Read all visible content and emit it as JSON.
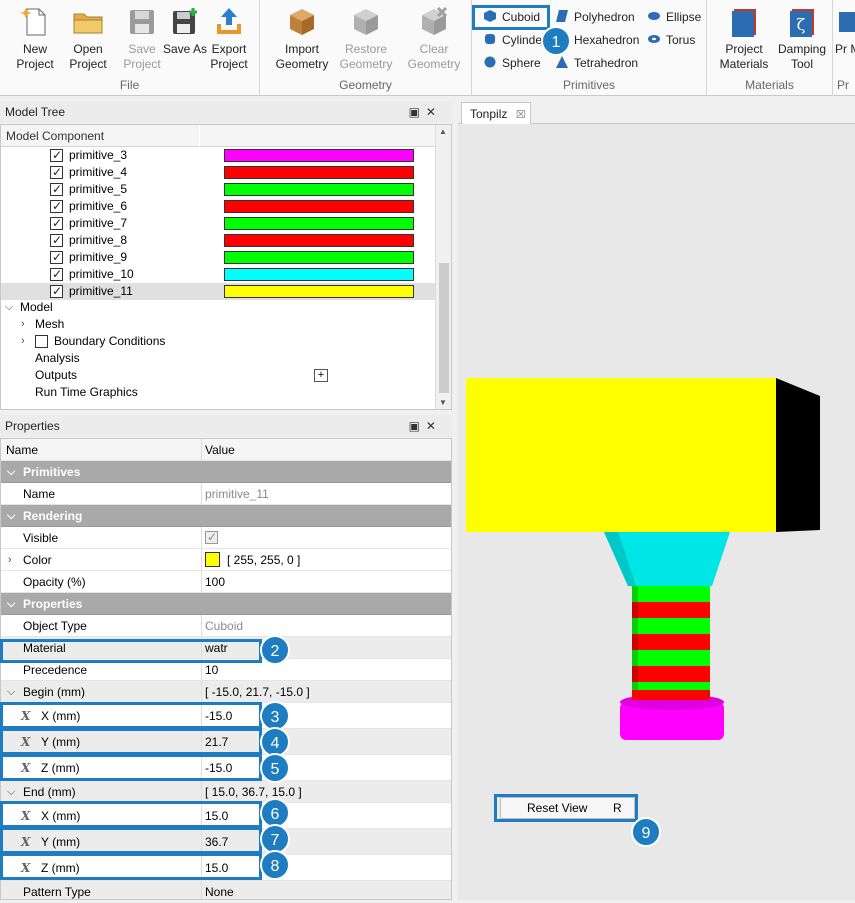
{
  "ribbon": {
    "groups": {
      "file": "File",
      "geometry": "Geometry",
      "primitives": "Primitives",
      "materials": "Materials",
      "last": "Pr"
    },
    "buttons": {
      "new_project": "New Project",
      "open_project": "Open Project",
      "save_project": "Save Project",
      "save_as": "Save As",
      "export_project": "Export Project",
      "import_geometry": "Import Geometry",
      "restore_geometry": "Restore Geometry",
      "clear_geometry": "Clear Geometry",
      "project_materials": "Project Materials",
      "damping_tool": "Damping Tool",
      "partial": "Pr M"
    },
    "primitives": {
      "cuboid": "Cuboid",
      "cylinder": "Cylinder",
      "sphere": "Sphere",
      "polyhedron": "Polyhedron",
      "hexahedron": "Hexahedron",
      "tetrahedron": "Tetrahedron",
      "ellipse": "Ellipse",
      "torus": "Torus"
    }
  },
  "model_tree": {
    "title": "Model Tree",
    "column": "Model Component",
    "primitives": [
      {
        "label": "primitive_3",
        "color": "#ff00ff"
      },
      {
        "label": "primitive_4",
        "color": "#ff0000"
      },
      {
        "label": "primitive_5",
        "color": "#00ff00"
      },
      {
        "label": "primitive_6",
        "color": "#ff0000"
      },
      {
        "label": "primitive_7",
        "color": "#00ff00"
      },
      {
        "label": "primitive_8",
        "color": "#ff0000"
      },
      {
        "label": "primitive_9",
        "color": "#00ff00"
      },
      {
        "label": "primitive_10",
        "color": "#00ffff"
      },
      {
        "label": "primitive_11",
        "color": "#ffff00"
      }
    ],
    "model": "Model",
    "mesh": "Mesh",
    "boundary_conditions": "Boundary Conditions",
    "analysis": "Analysis",
    "outputs": "Outputs",
    "outputs_add": "+",
    "run_time_graphics": "Run Time Graphics"
  },
  "properties": {
    "title": "Properties",
    "col_name": "Name",
    "col_value": "Value",
    "sec_primitives": "Primitives",
    "name_label": "Name",
    "name_value": "primitive_11",
    "sec_rendering": "Rendering",
    "visible_label": "Visible",
    "visible_checked": true,
    "color_label": "Color",
    "color_value": "[ 255, 255, 0 ]",
    "color_swatch": "#ffff00",
    "opacity_label": "Opacity (%)",
    "opacity_value": "100",
    "sec_properties": "Properties",
    "object_type_label": "Object Type",
    "object_type_value": "Cuboid",
    "material_label": "Material",
    "material_value": "watr",
    "precedence_label": "Precedence",
    "precedence_value": "10",
    "begin_label": "Begin (mm)",
    "begin_value": "[ -15.0, 21.7, -15.0 ]",
    "begin_x_label": "X (mm)",
    "begin_x_value": "-15.0",
    "begin_y_label": "Y (mm)",
    "begin_y_value": "21.7",
    "begin_z_label": "Z (mm)",
    "begin_z_value": "-15.0",
    "end_label": "End (mm)",
    "end_value": "[ 15.0, 36.7, 15.0 ]",
    "end_x_label": "X (mm)",
    "end_x_value": "15.0",
    "end_y_label": "Y (mm)",
    "end_y_value": "36.7",
    "end_z_label": "Z (mm)",
    "end_z_value": "15.0",
    "pattern_label": "Pattern Type",
    "pattern_value": "None",
    "x_glyph": "X"
  },
  "viewport": {
    "tab_label": "Tonpilz",
    "tab_close": "☒",
    "reset_view": "Reset View",
    "reset_shortcut": "R"
  },
  "badges": [
    "1",
    "2",
    "3",
    "4",
    "5",
    "6",
    "7",
    "8",
    "9"
  ]
}
